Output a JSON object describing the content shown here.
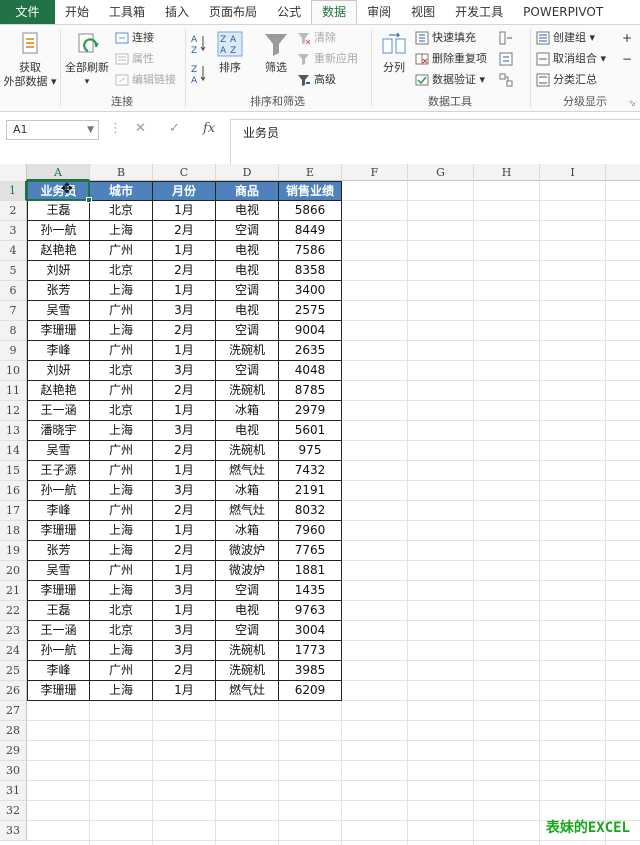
{
  "ribbon_tabs": [
    {
      "label": "文件"
    },
    {
      "label": "开始"
    },
    {
      "label": "工具箱"
    },
    {
      "label": "插入"
    },
    {
      "label": "页面布局"
    },
    {
      "label": "公式"
    },
    {
      "label": "数据"
    },
    {
      "label": "审阅"
    },
    {
      "label": "视图"
    },
    {
      "label": "开发工具"
    },
    {
      "label": "POWERPIVOT"
    }
  ],
  "active_tab": "数据",
  "ribbon": {
    "get_external": {
      "line1": "获取",
      "line2": "外部数据"
    },
    "refresh_all": "全部刷新",
    "connections": "连接",
    "properties": "属性",
    "edit_links": "编辑链接",
    "group_connections": "连接",
    "sort_az": "A→Z",
    "sort_za": "Z→A",
    "sort": "排序",
    "filter": "筛选",
    "clear": "清除",
    "reapply": "重新应用",
    "advanced": "高级",
    "group_sort_filter": "排序和筛选",
    "text_to_columns": "分列",
    "flash_fill": "快速填充",
    "remove_duplicates": "删除重复项",
    "data_validation": "数据验证",
    "group_data_tools": "数据工具",
    "group": "创建组",
    "ungroup": "取消组合",
    "subtotal": "分类汇总",
    "group_outline": "分级显示"
  },
  "formula_bar": {
    "name_box": "A1",
    "content": "业务员"
  },
  "columns": [
    "A",
    "B",
    "C",
    "D",
    "E",
    "F",
    "G",
    "H",
    "I"
  ],
  "row_count": 33,
  "table": {
    "headers": [
      "业务员",
      "城市",
      "月份",
      "商品",
      "销售业绩"
    ],
    "rows": [
      [
        "王磊",
        "北京",
        "1月",
        "电视",
        "5866"
      ],
      [
        "孙一航",
        "上海",
        "2月",
        "空调",
        "8449"
      ],
      [
        "赵艳艳",
        "广州",
        "1月",
        "电视",
        "7586"
      ],
      [
        "刘妍",
        "北京",
        "2月",
        "电视",
        "8358"
      ],
      [
        "张芳",
        "上海",
        "1月",
        "空调",
        "3400"
      ],
      [
        "吴雪",
        "广州",
        "3月",
        "电视",
        "2575"
      ],
      [
        "李珊珊",
        "上海",
        "2月",
        "空调",
        "9004"
      ],
      [
        "李峰",
        "广州",
        "1月",
        "洗碗机",
        "2635"
      ],
      [
        "刘妍",
        "北京",
        "3月",
        "空调",
        "4048"
      ],
      [
        "赵艳艳",
        "广州",
        "2月",
        "洗碗机",
        "8785"
      ],
      [
        "王一涵",
        "北京",
        "1月",
        "冰箱",
        "2979"
      ],
      [
        "潘晓宇",
        "上海",
        "3月",
        "电视",
        "5601"
      ],
      [
        "吴雪",
        "广州",
        "2月",
        "洗碗机",
        "975"
      ],
      [
        "王子源",
        "广州",
        "1月",
        "燃气灶",
        "7432"
      ],
      [
        "孙一航",
        "上海",
        "3月",
        "冰箱",
        "2191"
      ],
      [
        "李峰",
        "广州",
        "2月",
        "燃气灶",
        "8032"
      ],
      [
        "李珊珊",
        "上海",
        "1月",
        "冰箱",
        "7960"
      ],
      [
        "张芳",
        "上海",
        "2月",
        "微波炉",
        "7765"
      ],
      [
        "吴雪",
        "广州",
        "1月",
        "微波炉",
        "1881"
      ],
      [
        "李珊珊",
        "上海",
        "3月",
        "空调",
        "1435"
      ],
      [
        "王磊",
        "北京",
        "1月",
        "电视",
        "9763"
      ],
      [
        "王一涵",
        "北京",
        "3月",
        "空调",
        "3004"
      ],
      [
        "孙一航",
        "上海",
        "3月",
        "洗碗机",
        "1773"
      ],
      [
        "李峰",
        "广州",
        "2月",
        "洗碗机",
        "3985"
      ],
      [
        "李珊珊",
        "上海",
        "1月",
        "燃气灶",
        "6209"
      ]
    ]
  },
  "watermark": "表妹的EXCEL",
  "colors": {
    "accent": "#217346",
    "header_fill": "#4f81bd",
    "watermark": "#1aa51a"
  }
}
